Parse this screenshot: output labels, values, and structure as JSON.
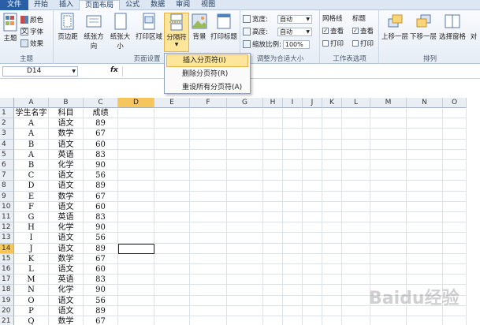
{
  "tabs": [
    "文件",
    "开始",
    "插入",
    "页面布局",
    "公式",
    "数据",
    "审阅",
    "视图"
  ],
  "ribbon": {
    "themes": {
      "big": "主题",
      "colors": "颜色",
      "fonts": "字体",
      "effects": "效果",
      "group": "主题"
    },
    "page_setup": {
      "margins": "页边距",
      "orientation": "纸张方向",
      "size": "纸张大小",
      "print_area": "打印区域",
      "breaks": "分隔符",
      "background": "背景",
      "print_titles": "打印标题",
      "group": "页面设置"
    },
    "scale": {
      "width_label": "宽度:",
      "width_value": "自动",
      "height_label": "高度:",
      "height_value": "自动",
      "scale_label": "缩放比例:",
      "scale_value": "100%",
      "group": "调整为合适大小"
    },
    "sheet_options": {
      "gridlines": "网格线",
      "headings": "标题",
      "view": "查看",
      "print": "打印",
      "group": "工作表选项"
    },
    "arrange": {
      "bring_forward": "上移一层",
      "send_backward": "下移一层",
      "selection_pane": "选择窗格",
      "align": "对",
      "group": "排列"
    }
  },
  "formula_bar": {
    "name_box": "D14",
    "fx": "fx"
  },
  "breaks_menu": {
    "items": [
      "插入分页符(I)",
      "删除分页符(R)",
      "重设所有分页符(A)"
    ]
  },
  "columns": [
    "A",
    "B",
    "C",
    "D",
    "E",
    "F",
    "G",
    "H",
    "I",
    "J",
    "K",
    "L",
    "M",
    "N",
    "O"
  ],
  "rows": [
    [
      "学生名字",
      "科目",
      "成绩"
    ],
    [
      "A",
      "语文",
      "89"
    ],
    [
      "A",
      "数学",
      "67"
    ],
    [
      "B",
      "语文",
      "60"
    ],
    [
      "A",
      "英语",
      "83"
    ],
    [
      "B",
      "化学",
      "90"
    ],
    [
      "C",
      "语文",
      "56"
    ],
    [
      "D",
      "语文",
      "89"
    ],
    [
      "E",
      "数学",
      "67"
    ],
    [
      "F",
      "语文",
      "60"
    ],
    [
      "G",
      "英语",
      "83"
    ],
    [
      "H",
      "化学",
      "90"
    ],
    [
      "I",
      "语文",
      "56"
    ],
    [
      "J",
      "语文",
      "89"
    ],
    [
      "K",
      "数学",
      "67"
    ],
    [
      "L",
      "语文",
      "60"
    ],
    [
      "M",
      "英语",
      "83"
    ],
    [
      "N",
      "化学",
      "90"
    ],
    [
      "O",
      "语文",
      "56"
    ],
    [
      "P",
      "语文",
      "89"
    ],
    [
      "Q",
      "数学",
      "67"
    ]
  ],
  "row_numbers": [
    "1",
    "2",
    "3",
    "4",
    "5",
    "6",
    "7",
    "8",
    "9",
    "10",
    "11",
    "12",
    "13",
    "14",
    "15",
    "16",
    "17",
    "18",
    "19",
    "20",
    "21"
  ],
  "active_cell": "D14",
  "watermark": "Baidu经验",
  "colors": {
    "accent": "#2a5fa8",
    "highlight": "#fde69a",
    "header_active": "#f6c65d"
  }
}
